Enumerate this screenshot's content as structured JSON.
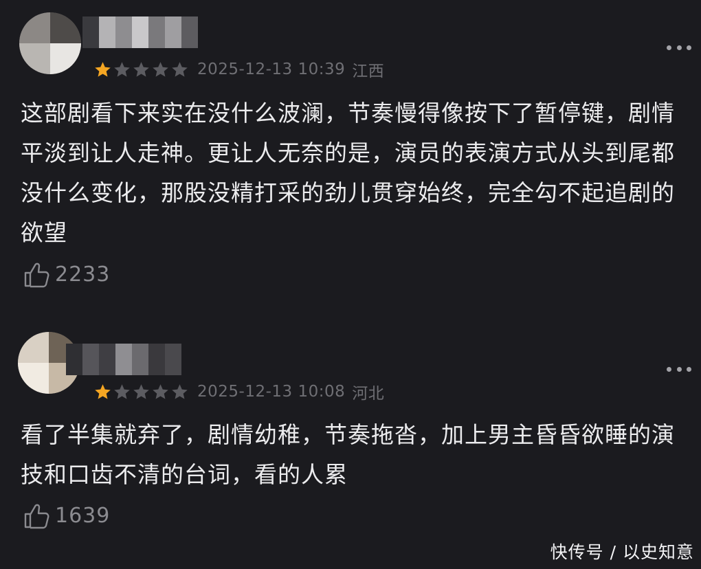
{
  "colors": {
    "background": "#1b1b1f",
    "star_filled": "#f5a623",
    "star_empty": "#5c5c61",
    "text": "#ececee",
    "meta": "#6f6f74"
  },
  "reviews": [
    {
      "rating": 1,
      "max_rating": 5,
      "date": "2025-12-13 10:39",
      "location": "江西",
      "content": "这部剧看下来实在没什么波澜，节奏慢得像按下了暂停键，剧情平淡到让人走神。更让人无奈的是，演员的表演方式从头到尾都没什么变化，那股没精打采的劲儿贯穿始终，完全勾不起追剧的欲望",
      "likes": "2233"
    },
    {
      "rating": 1,
      "max_rating": 5,
      "date": "2025-12-13 10:08",
      "location": "河北",
      "content": "看了半集就弃了，剧情幼稚，节奏拖沓，加上男主昏昏欲睡的演技和口齿不清的台词，看的人累",
      "likes": "1639"
    }
  ],
  "icons": {
    "more": "more-dots-icon",
    "like": "thumbs-up-icon",
    "star": "star-icon"
  },
  "watermark": "快传号 / 以史知意"
}
